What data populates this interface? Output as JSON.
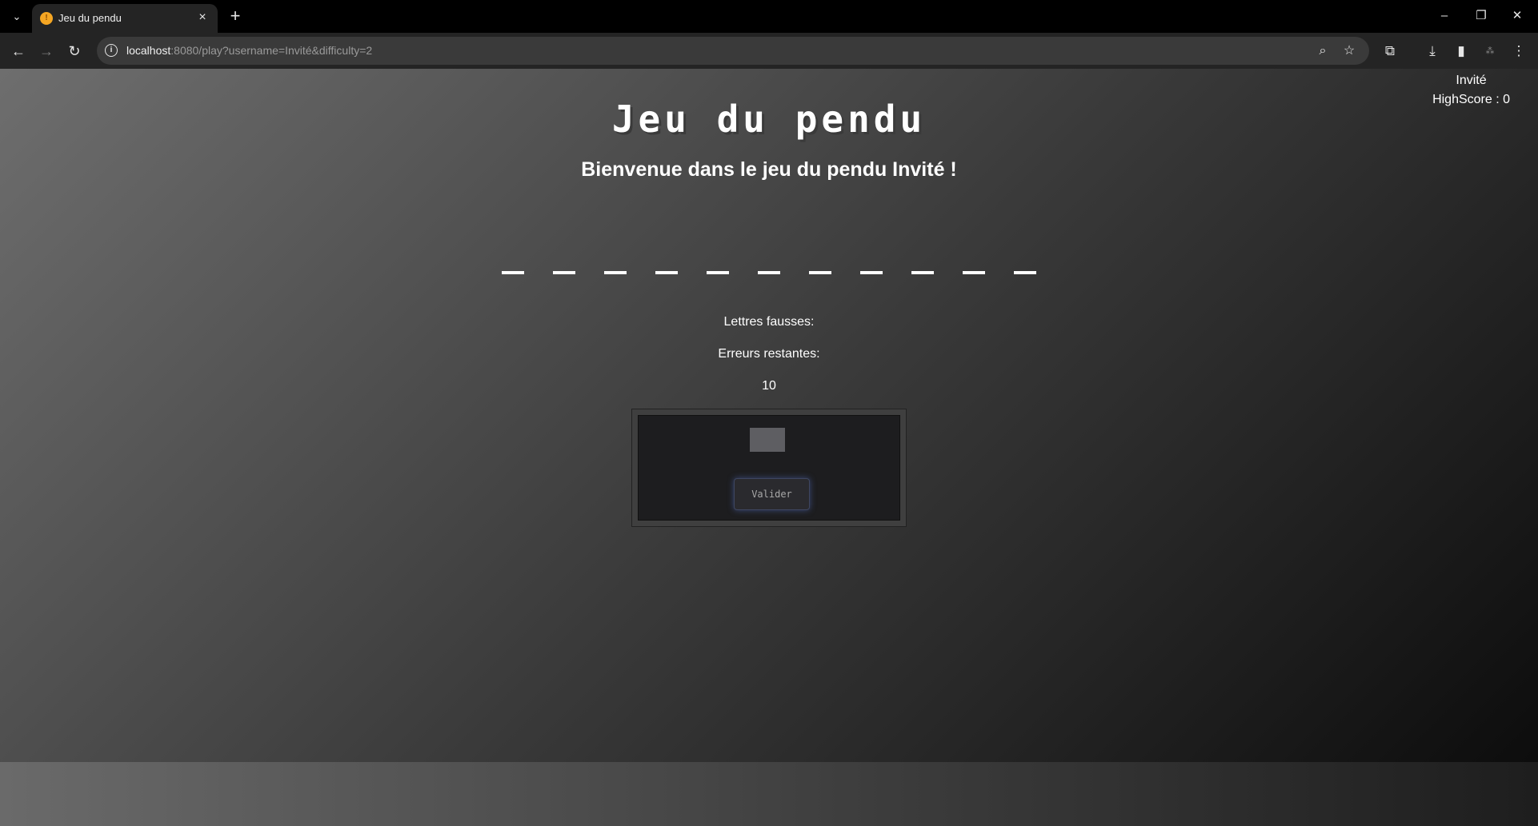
{
  "browser": {
    "tab_title": "Jeu du pendu",
    "url_host": "localhost",
    "url_rest": ":8080/play?username=Invité&difficulty=2",
    "icons": {
      "tab_search": "chevron-down-icon",
      "new_tab": "plus-icon",
      "back": "arrow-left-icon",
      "forward": "arrow-right-icon",
      "reload": "reload-icon",
      "zoom": "zoom-icon",
      "bookmark": "star-icon",
      "extensions": "puzzle-icon",
      "downloads": "download-icon",
      "side_panel": "side-panel-icon",
      "menu": "kebab-menu-icon"
    }
  },
  "user": {
    "name": "Invité",
    "highscore": "HighScore : 0"
  },
  "game": {
    "title": "Jeu du pendu",
    "welcome": "Bienvenue dans le jeu du pendu Invité !",
    "word_length": 11,
    "wrong_letters_label": "Lettres fausses:",
    "wrong_letters": "",
    "errors_label": "Erreurs restantes:",
    "errors_remaining": "10",
    "letter_input_value": "",
    "validate_label": "Valider"
  },
  "colors": {
    "background_start": "#6e6e6e",
    "background_end": "#0a0a0a",
    "panel": "#1d1d1f",
    "button_glow": "#3a4a7a"
  }
}
